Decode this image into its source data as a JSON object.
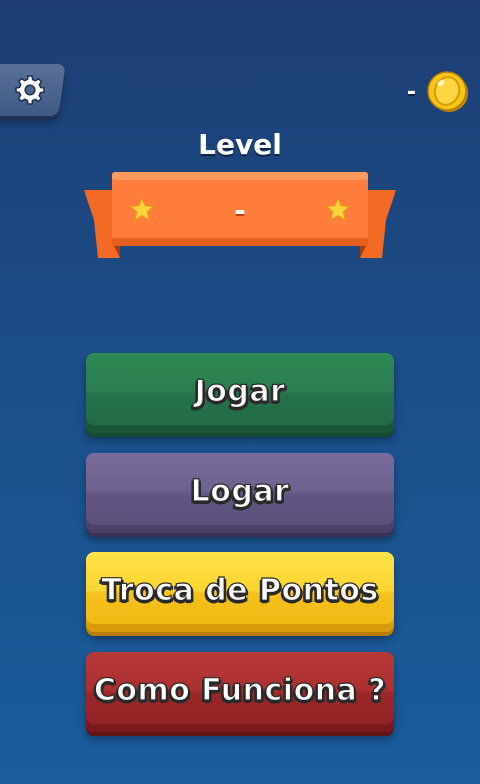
{
  "header": {
    "settings_icon": "gear-icon",
    "coins": {
      "value": "-",
      "icon": "coin-icon"
    }
  },
  "level": {
    "title": "Level",
    "value": "-",
    "star_icon": "star-icon"
  },
  "menu": {
    "play_label": "Jogar",
    "login_label": "Logar",
    "points_exchange_label": "Troca de Pontos",
    "how_it_works_label": "Como Funciona ?"
  },
  "colors": {
    "background": "#1b4f8a",
    "ribbon": "#ff7a3a",
    "play": "#2a7d4d",
    "login": "#6e6190",
    "points_exchange": "#fcd530",
    "how_it_works": "#ab3030",
    "coin": "#f7c418"
  }
}
